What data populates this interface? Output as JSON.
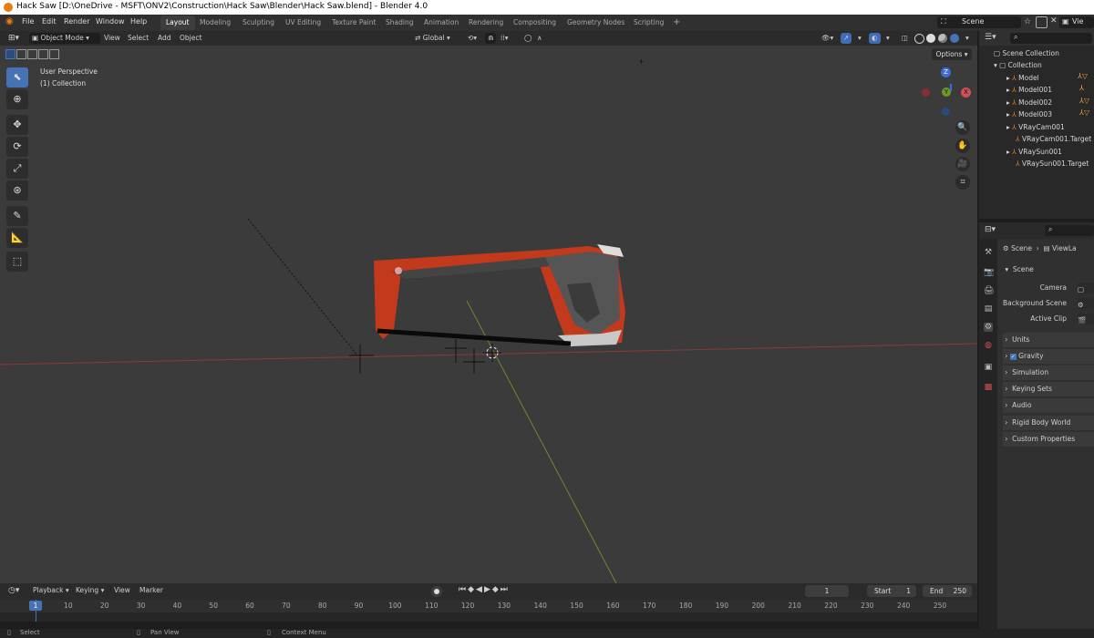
{
  "window_title": "Hack Saw [D:\\OneDrive - MSFT\\ONV2\\Construction\\Hack Saw\\Blender\\Hack Saw.blend] - Blender 4.0",
  "menu": [
    "File",
    "Edit",
    "Render",
    "Window",
    "Help"
  ],
  "workspaces": [
    "Layout",
    "Modeling",
    "Sculpting",
    "UV Editing",
    "Texture Paint",
    "Shading",
    "Animation",
    "Rendering",
    "Compositing",
    "Geometry Nodes",
    "Scripting"
  ],
  "active_workspace": "Layout",
  "add_workspace": "+",
  "scene_name": "Scene",
  "view_layer_short": "Vie",
  "viewport_header": {
    "mode": "Object Mode",
    "menus": [
      "View",
      "Select",
      "Add",
      "Object"
    ],
    "orientation": "Global",
    "options": "Options"
  },
  "viewport_info": {
    "line1": "User Perspective",
    "line2": "(1) Collection"
  },
  "gizmo": {
    "z": "Z",
    "y": "Y",
    "x": "X"
  },
  "outliner": {
    "root": "Scene Collection",
    "collection": "Collection",
    "items": [
      "Model",
      "Model001",
      "Model002",
      "Model003",
      "VRayCam001",
      "VRayCam001.Target",
      "VRaySun001",
      "VRaySun001.Target"
    ]
  },
  "properties": {
    "breadcrumb_scene": "Scene",
    "breadcrumb_viewlayer": "ViewLa",
    "panel_title": "Scene",
    "fields": [
      {
        "label": "Camera"
      },
      {
        "label": "Background Scene"
      },
      {
        "label": "Active Clip"
      }
    ],
    "sections": [
      "Units",
      "Gravity",
      "Simulation",
      "Keying Sets",
      "Audio",
      "Rigid Body World",
      "Custom Properties"
    ],
    "gravity_checked": true
  },
  "timeline": {
    "menus": [
      "Playback",
      "Keying",
      "View",
      "Marker"
    ],
    "current_frame": "1",
    "start_label": "Start",
    "start": "1",
    "end_label": "End",
    "end": "250",
    "ticks": [
      "1",
      "10",
      "20",
      "30",
      "40",
      "50",
      "60",
      "70",
      "80",
      "90",
      "100",
      "110",
      "120",
      "130",
      "140",
      "150",
      "160",
      "170",
      "180",
      "190",
      "200",
      "210",
      "220",
      "230",
      "240",
      "250"
    ]
  },
  "status": {
    "select": "Select",
    "pan": "Pan View",
    "context": "Context Menu"
  },
  "colors": {
    "accent": "#4772b3",
    "saw_body": "#c2391c",
    "object_orange": "#e87d0d"
  }
}
